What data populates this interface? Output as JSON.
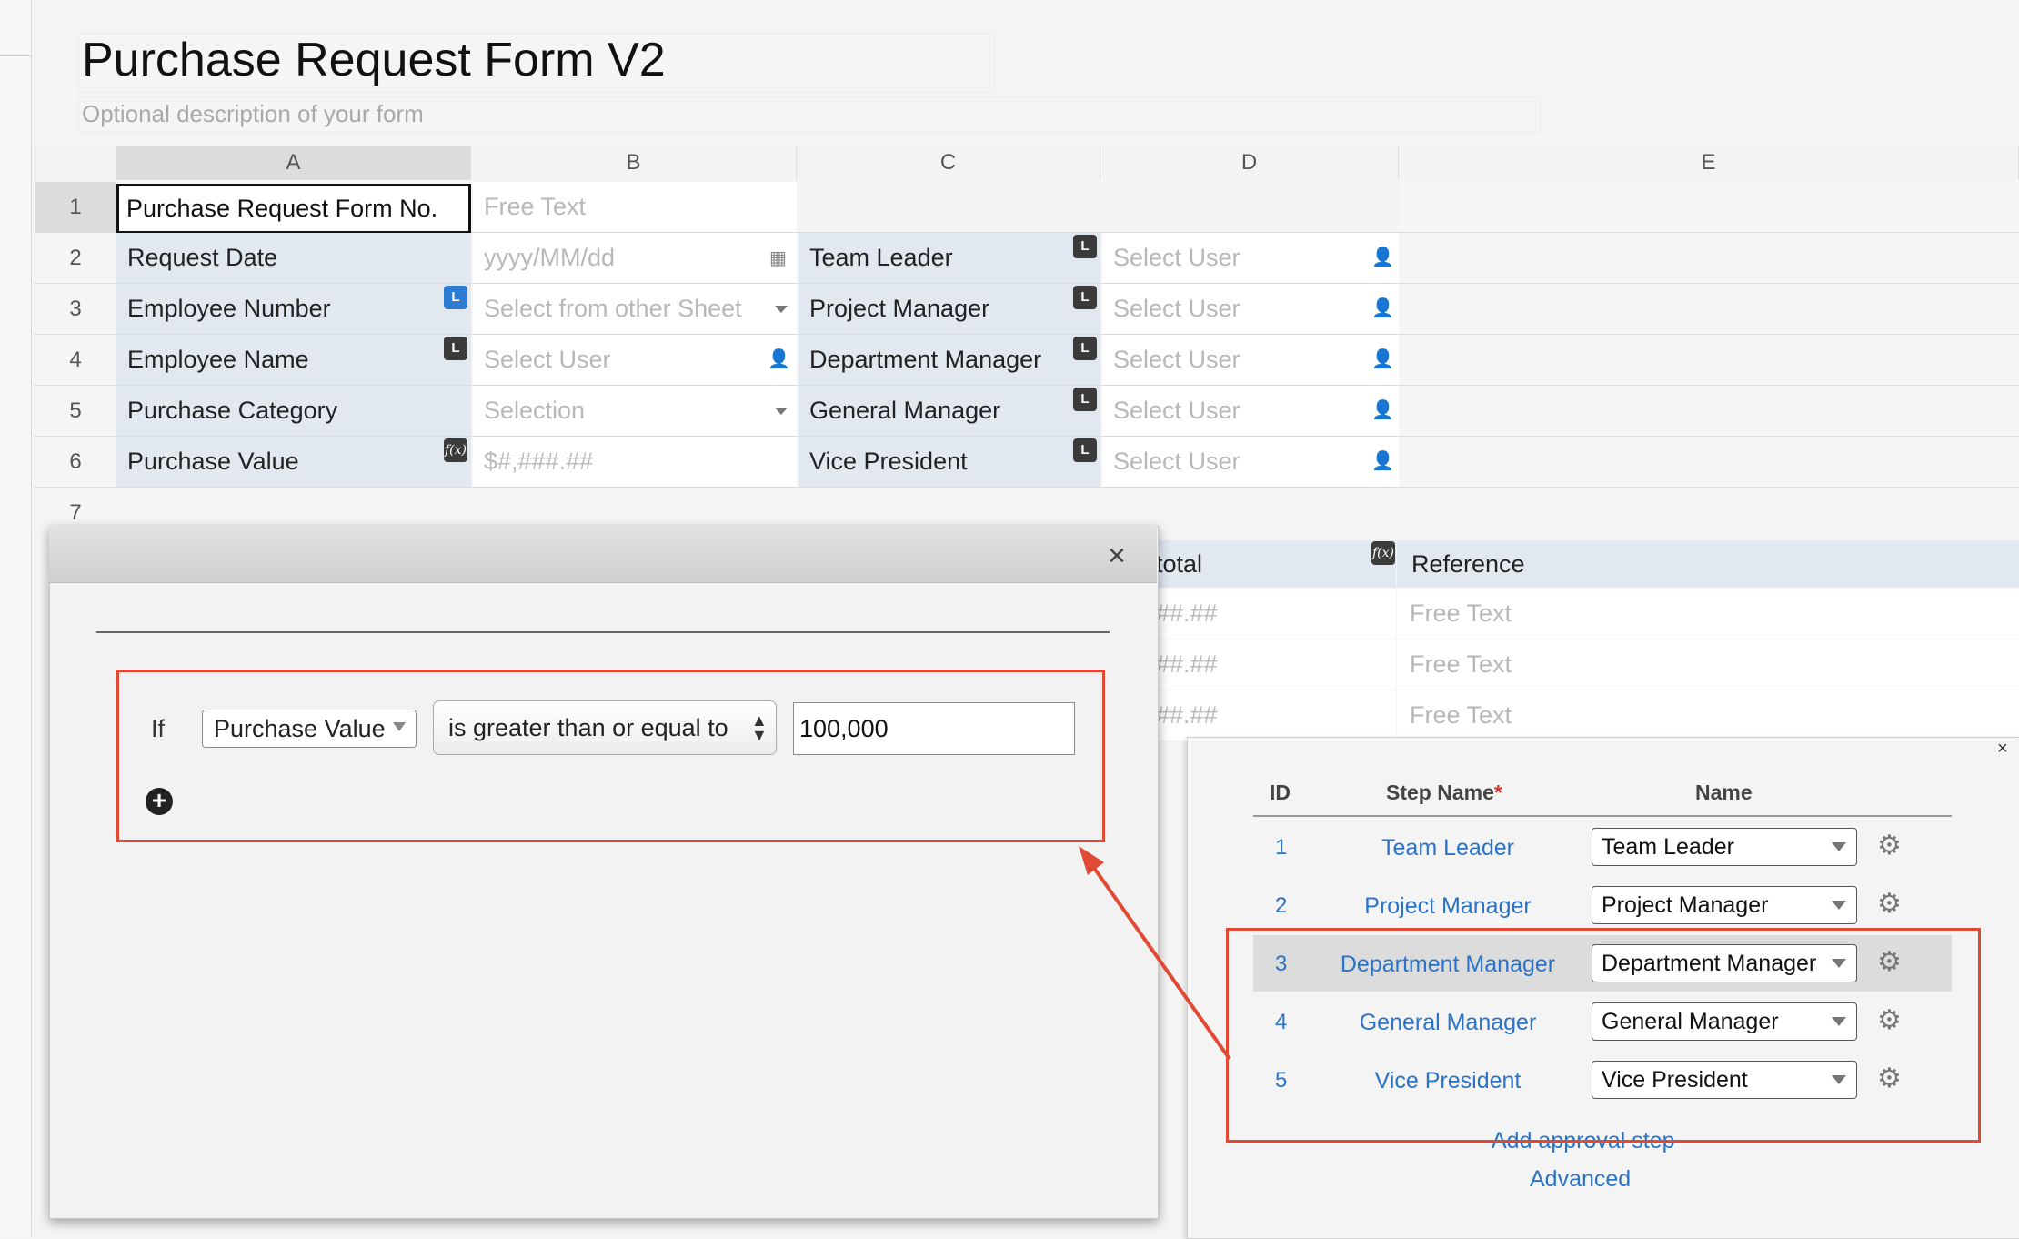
{
  "form": {
    "title": "Purchase Request Form V2",
    "description": "Optional description of your form"
  },
  "columns": [
    "A",
    "B",
    "C",
    "D",
    "E"
  ],
  "rows": [
    "1",
    "2",
    "3",
    "4",
    "5",
    "6",
    "7"
  ],
  "grid": {
    "r1": {
      "a": "Purchase Request Form No.",
      "b": "Free Text"
    },
    "r2": {
      "a": "Request Date",
      "b": "yyyy/MM/dd",
      "c": "Team Leader",
      "d": "Select User"
    },
    "r3": {
      "a": "Employee Number",
      "b": "Select from other Sheet",
      "c": "Project Manager",
      "d": "Select User"
    },
    "r4": {
      "a": "Employee Name",
      "b": "Select User",
      "c": "Department Manager",
      "d": "Select User"
    },
    "r5": {
      "a": "Purchase Category",
      "b": "Selection",
      "c": "General Manager",
      "d": "Select User"
    },
    "r6": {
      "a": "Purchase Value",
      "b": "$#,###.##",
      "c": "Vice President",
      "d": "Select User"
    }
  },
  "badges": {
    "link": "L",
    "formula": "f(x)"
  },
  "subtable": {
    "total_header": "total",
    "reference_header": "Reference",
    "rows": [
      {
        "total": "##.##",
        "reference": "Free Text"
      },
      {
        "total": "##.##",
        "reference": "Free Text"
      },
      {
        "total": "##.##",
        "reference": "Free Text"
      }
    ]
  },
  "condition_dialog": {
    "close": "×",
    "if_label": "If",
    "field": "Purchase Value",
    "operator": "is greater than or equal to",
    "value": "100,000",
    "add": "+"
  },
  "approval": {
    "close": "×",
    "headers": {
      "id": "ID",
      "step_name": "Step Name",
      "required_mark": "*",
      "name": "Name"
    },
    "steps": [
      {
        "id": "1",
        "step_name": "Team Leader",
        "name": "Team Leader"
      },
      {
        "id": "2",
        "step_name": "Project Manager",
        "name": "Project Manager"
      },
      {
        "id": "3",
        "step_name": "Department Manager",
        "name": "Department Manager"
      },
      {
        "id": "4",
        "step_name": "General Manager",
        "name": "General Manager"
      },
      {
        "id": "5",
        "step_name": "Vice President",
        "name": "Vice President"
      }
    ],
    "add_step": "Add approval step",
    "advanced": "Advanced"
  },
  "icons": {
    "calendar": "calendar-icon",
    "user": "user-icon",
    "dropdown": "chevron-down-icon",
    "gear": "gear-icon",
    "close": "close-icon"
  },
  "colors": {
    "label_bg": "#e2e8f0",
    "link": "#2a73c7",
    "highlight": "#e04a35"
  }
}
